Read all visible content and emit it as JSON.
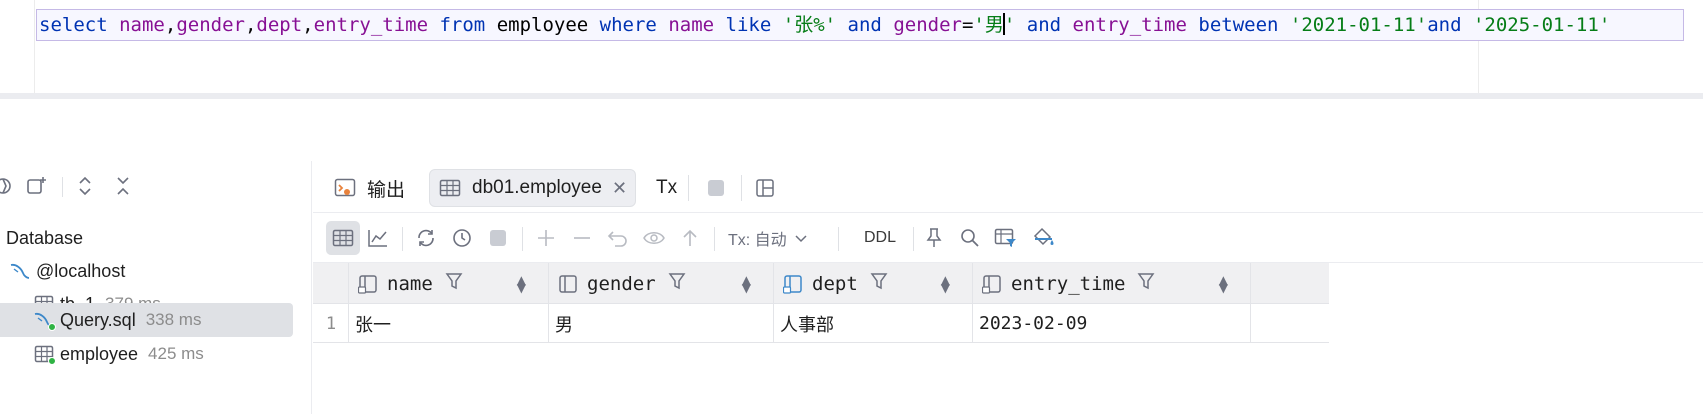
{
  "editor": {
    "tokens": [
      {
        "t": "select",
        "c": "kw"
      },
      {
        "t": " ",
        "c": "op"
      },
      {
        "t": "name",
        "c": "col"
      },
      {
        "t": ",",
        "c": "op"
      },
      {
        "t": "gender",
        "c": "col"
      },
      {
        "t": ",",
        "c": "op"
      },
      {
        "t": "dept",
        "c": "col"
      },
      {
        "t": ",",
        "c": "op"
      },
      {
        "t": "entry_time",
        "c": "col"
      },
      {
        "t": " ",
        "c": "op"
      },
      {
        "t": "from",
        "c": "kw"
      },
      {
        "t": " ",
        "c": "op"
      },
      {
        "t": "employee",
        "c": "tbl"
      },
      {
        "t": " ",
        "c": "op"
      },
      {
        "t": "where",
        "c": "kw"
      },
      {
        "t": " ",
        "c": "op"
      },
      {
        "t": "name",
        "c": "col"
      },
      {
        "t": " ",
        "c": "op"
      },
      {
        "t": "like",
        "c": "kw"
      },
      {
        "t": " ",
        "c": "op"
      },
      {
        "t": "'张%'",
        "c": "str"
      },
      {
        "t": " ",
        "c": "op"
      },
      {
        "t": "and",
        "c": "kw"
      },
      {
        "t": " ",
        "c": "op"
      },
      {
        "t": "gender",
        "c": "col"
      },
      {
        "t": "=",
        "c": "op"
      },
      {
        "t": "'男",
        "c": "str"
      },
      {
        "t": "|caret|",
        "c": "caret"
      },
      {
        "t": "'",
        "c": "str"
      },
      {
        "t": " ",
        "c": "op"
      },
      {
        "t": "and",
        "c": "kw"
      },
      {
        "t": " ",
        "c": "op"
      },
      {
        "t": "entry_time",
        "c": "col"
      },
      {
        "t": " ",
        "c": "op"
      },
      {
        "t": "between",
        "c": "kw"
      },
      {
        "t": " ",
        "c": "op"
      },
      {
        "t": "'2021-01-11'",
        "c": "str"
      },
      {
        "t": "and",
        "c": "kw"
      },
      {
        "t": " ",
        "c": "op"
      },
      {
        "t": "'2025-01-11'",
        "c": "str"
      }
    ]
  },
  "left_panel": {
    "root_label": "Database",
    "items": [
      {
        "label": "@localhost",
        "ms": "",
        "icon": "mysql-icon"
      },
      {
        "label": "tb_1",
        "ms": "379 ms",
        "icon": "table-icon"
      },
      {
        "label": "Query.sql",
        "ms": "338 ms",
        "icon": "mysql-icon"
      },
      {
        "label": "employee",
        "ms": "425 ms",
        "icon": "table-icon"
      }
    ]
  },
  "tabs": {
    "output_label": "输出",
    "active_tab_label": "db01.employee",
    "tx_label": "Tx"
  },
  "grid_toolbar": {
    "tx_mode": "Tx: 自动",
    "ddl_label": "DDL"
  },
  "grid": {
    "columns": [
      "name",
      "gender",
      "dept",
      "entry_time"
    ],
    "rows": [
      {
        "num": "1",
        "cells": [
          "张一",
          "男",
          "人事部",
          "2023-02-09"
        ]
      }
    ]
  },
  "colors": {
    "keyword": "#0033b3",
    "column": "#871094",
    "string": "#067d17",
    "selection_bg": "#dfe1e5"
  }
}
